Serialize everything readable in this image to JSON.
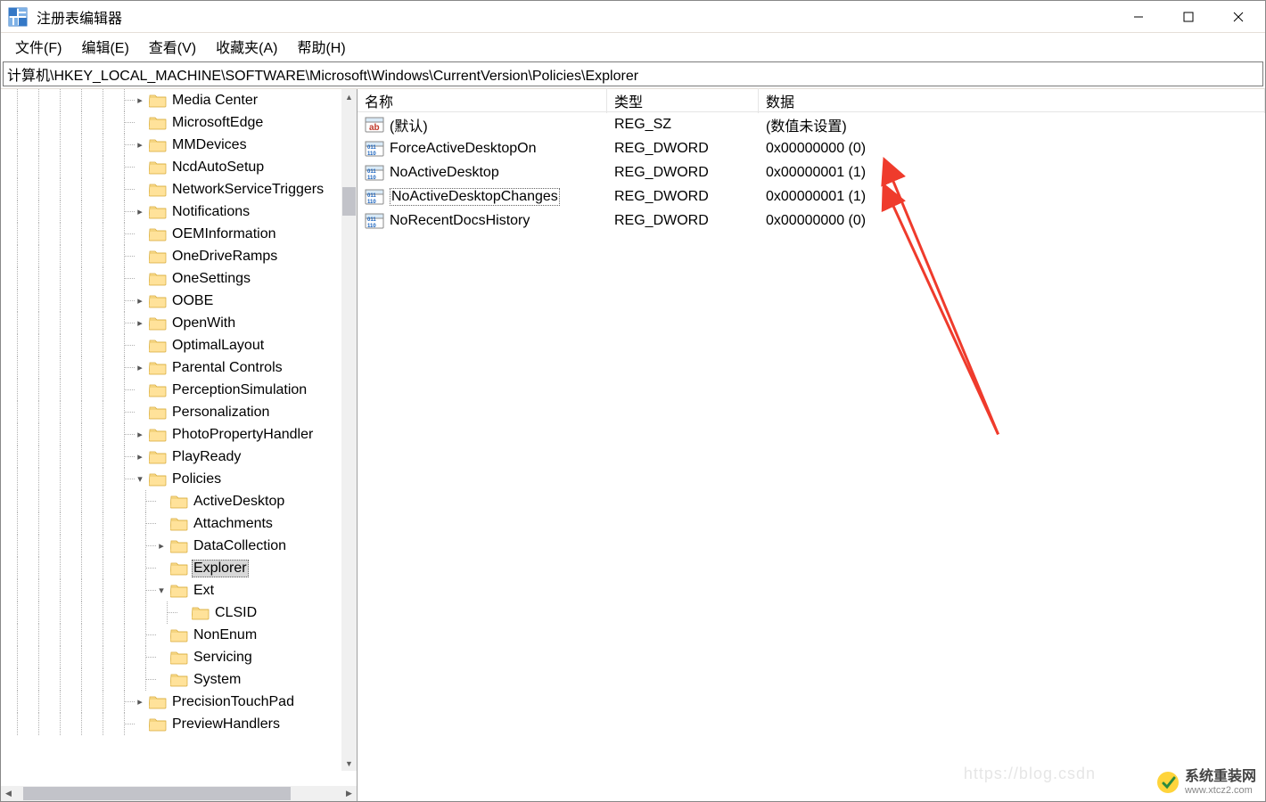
{
  "window": {
    "title": "注册表编辑器"
  },
  "menu": {
    "file": "文件(F)",
    "edit": "编辑(E)",
    "view": "查看(V)",
    "favorites": "收藏夹(A)",
    "help": "帮助(H)"
  },
  "address": "计算机\\HKEY_LOCAL_MACHINE\\SOFTWARE\\Microsoft\\Windows\\CurrentVersion\\Policies\\Explorer",
  "tree": [
    {
      "level": 6,
      "caret": ">",
      "label": "Media Center"
    },
    {
      "level": 6,
      "caret": "",
      "label": "MicrosoftEdge"
    },
    {
      "level": 6,
      "caret": ">",
      "label": "MMDevices"
    },
    {
      "level": 6,
      "caret": "",
      "label": "NcdAutoSetup"
    },
    {
      "level": 6,
      "caret": "",
      "label": "NetworkServiceTriggers"
    },
    {
      "level": 6,
      "caret": ">",
      "label": "Notifications"
    },
    {
      "level": 6,
      "caret": "",
      "label": "OEMInformation"
    },
    {
      "level": 6,
      "caret": "",
      "label": "OneDriveRamps"
    },
    {
      "level": 6,
      "caret": "",
      "label": "OneSettings"
    },
    {
      "level": 6,
      "caret": ">",
      "label": "OOBE"
    },
    {
      "level": 6,
      "caret": ">",
      "label": "OpenWith"
    },
    {
      "level": 6,
      "caret": "",
      "label": "OptimalLayout"
    },
    {
      "level": 6,
      "caret": ">",
      "label": "Parental Controls"
    },
    {
      "level": 6,
      "caret": "",
      "label": "PerceptionSimulation"
    },
    {
      "level": 6,
      "caret": "",
      "label": "Personalization"
    },
    {
      "level": 6,
      "caret": ">",
      "label": "PhotoPropertyHandler"
    },
    {
      "level": 6,
      "caret": ">",
      "label": "PlayReady"
    },
    {
      "level": 6,
      "caret": "v",
      "label": "Policies"
    },
    {
      "level": 7,
      "caret": "",
      "label": "ActiveDesktop"
    },
    {
      "level": 7,
      "caret": "",
      "label": "Attachments"
    },
    {
      "level": 7,
      "caret": ">",
      "label": "DataCollection"
    },
    {
      "level": 7,
      "caret": "",
      "label": "Explorer",
      "selected": true
    },
    {
      "level": 7,
      "caret": "v",
      "label": "Ext"
    },
    {
      "level": 8,
      "caret": "",
      "label": "CLSID"
    },
    {
      "level": 7,
      "caret": "",
      "label": "NonEnum"
    },
    {
      "level": 7,
      "caret": "",
      "label": "Servicing"
    },
    {
      "level": 7,
      "caret": "",
      "label": "System"
    },
    {
      "level": 6,
      "caret": ">",
      "label": "PrecisionTouchPad"
    },
    {
      "level": 6,
      "caret": "",
      "label": "PreviewHandlers"
    }
  ],
  "columns": {
    "name": "名称",
    "type": "类型",
    "data": "数据"
  },
  "values": [
    {
      "icon": "sz",
      "name": "(默认)",
      "type": "REG_SZ",
      "data": "(数值未设置)"
    },
    {
      "icon": "dword",
      "name": "ForceActiveDesktopOn",
      "type": "REG_DWORD",
      "data": "0x00000000 (0)"
    },
    {
      "icon": "dword",
      "name": "NoActiveDesktop",
      "type": "REG_DWORD",
      "data": "0x00000001 (1)"
    },
    {
      "icon": "dword",
      "name": "NoActiveDesktopChanges",
      "type": "REG_DWORD",
      "data": "0x00000001 (1)",
      "selected": true
    },
    {
      "icon": "dword",
      "name": "NoRecentDocsHistory",
      "type": "REG_DWORD",
      "data": "0x00000000 (0)"
    }
  ],
  "watermark": {
    "main": "系统重装网",
    "sub": "www.xtcz2.com"
  },
  "watermark_csdn": "https://blog.csdn"
}
